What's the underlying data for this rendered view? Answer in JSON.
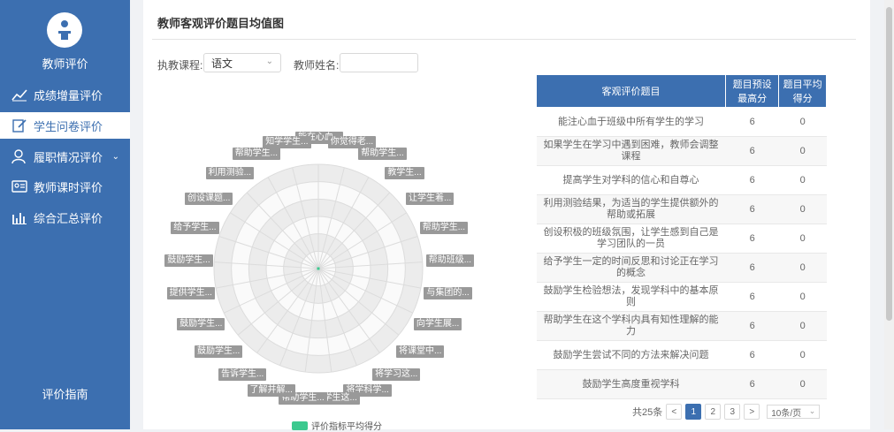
{
  "sidebar": {
    "title": "教师评价",
    "items": [
      {
        "label": "成绩增量评价",
        "icon": "trend-icon",
        "active": false
      },
      {
        "label": "学生问卷评价",
        "icon": "edit-icon",
        "active": true
      },
      {
        "label": "履职情况评价",
        "icon": "user-icon",
        "active": false,
        "has_caret": true
      },
      {
        "label": "教师课时评价",
        "icon": "id-card-icon",
        "active": false
      },
      {
        "label": "综合汇总评价",
        "icon": "bar-chart-icon",
        "active": false
      }
    ],
    "guide": "评价指南"
  },
  "card": {
    "title": "教师客观评价题目均值图"
  },
  "filters": {
    "course_label": "执教课程:",
    "course_value": "语文",
    "teacher_label": "教师姓名:",
    "teacher_value": ""
  },
  "radar": {
    "labels": [
      "能在心血...",
      "你觉得老...",
      "帮助学生...",
      "教学生...",
      "让学生着...",
      "帮助学生...",
      "帮助班级...",
      "与集团的...",
      "向学生展...",
      "将课堂中...",
      "将学习这...",
      "将学科学...",
      "给学生这...",
      "帮助学生...",
      "了解并解...",
      "告诉学生...",
      "鼓励学生...",
      "鼓励学生...",
      "提供学生...",
      "鼓励学生...",
      "给予学生...",
      "创设课题...",
      "利用测验...",
      "帮助学生...",
      "知学学生..."
    ],
    "legend": "评价指标平均得分"
  },
  "chart_data": {
    "type": "radar",
    "categories": [
      "能在心血...",
      "你觉得老...",
      "帮助学生...",
      "教学生...",
      "让学生着...",
      "帮助学生...",
      "帮助班级...",
      "与集团的...",
      "向学生展...",
      "将课堂中...",
      "将学习这...",
      "将学科学...",
      "给学生这...",
      "帮助学生...",
      "了解并解...",
      "告诉学生...",
      "鼓励学生...",
      "鼓励学生...",
      "提供学生...",
      "鼓励学生...",
      "给予学生...",
      "创设课题...",
      "利用测验...",
      "帮助学生...",
      "知学学生..."
    ],
    "series": [
      {
        "name": "评价指标平均得分",
        "values": [
          0,
          0,
          0,
          0,
          0,
          0,
          0,
          0,
          0,
          0,
          0,
          0,
          0,
          0,
          0,
          0,
          0,
          0,
          0,
          0,
          0,
          0,
          0,
          0,
          0
        ]
      }
    ],
    "rlim": [
      0,
      6
    ],
    "rings": 6,
    "legend_position": "bottom"
  },
  "table": {
    "headers": [
      "客观评价题目",
      "题目预设最高分",
      "题目平均得分"
    ],
    "rows": [
      [
        "能注心血于班级中所有学生的学习",
        "6",
        "0"
      ],
      [
        "如果学生在学习中遇到困难，教师会调整课程",
        "6",
        "0"
      ],
      [
        "提高学生对学科的信心和自尊心",
        "6",
        "0"
      ],
      [
        "利用测验结果，为适当的学生提供额外的帮助或拓展",
        "6",
        "0"
      ],
      [
        "创设积极的班级氛围，让学生感到自己是学习团队的一员",
        "6",
        "0"
      ],
      [
        "给予学生一定的时间反思和讨论正在学习的概念",
        "6",
        "0"
      ],
      [
        "鼓励学生检验想法，发现学科中的基本原则",
        "6",
        "0"
      ],
      [
        "帮助学生在这个学科内具有知性理解的能力",
        "6",
        "0"
      ],
      [
        "鼓励学生尝试不同的方法来解决问题",
        "6",
        "0"
      ],
      [
        "鼓励学生高度重视学科",
        "6",
        "0"
      ]
    ]
  },
  "pager": {
    "total": "共25条",
    "prev": "<",
    "pages": [
      "1",
      "2",
      "3"
    ],
    "next": ">",
    "size": "10条/页"
  },
  "colors": {
    "sidebar": "#3c6fb0",
    "accent": "#3c6fb0",
    "series": "#3cc98f"
  }
}
